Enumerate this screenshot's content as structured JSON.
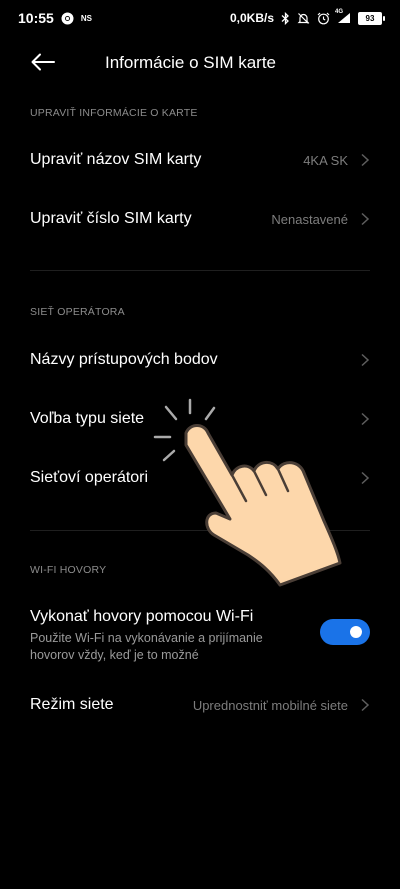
{
  "status_bar": {
    "time": "10:55",
    "ns_label": "NS",
    "speed": "0,0KB/s",
    "network_label": "4G",
    "battery": "93"
  },
  "header": {
    "title": "Informácie o SIM karte"
  },
  "sections": {
    "card_info": {
      "header": "UPRAVIŤ INFORMÁCIE O KARTE",
      "items": [
        {
          "label": "Upraviť názov SIM karty",
          "value": "4KA SK"
        },
        {
          "label": "Upraviť číslo SIM karty",
          "value": "Nenastavené"
        }
      ]
    },
    "operator_network": {
      "header": "SIEŤ OPERÁTORA",
      "items": [
        {
          "label": "Názvy prístupových bodov"
        },
        {
          "label": "Voľba typu siete"
        },
        {
          "label": "Sieťoví operátori"
        }
      ]
    },
    "wifi_calls": {
      "header": "WI-FI HOVORY",
      "title": "Vykonať hovory pomocou Wi-Fi",
      "description": "Použite Wi-Fi na vykonávanie a prijímanie hovorov vždy, keď je to možné",
      "toggle_on": true,
      "accent": "#1a73e8"
    },
    "network_mode": {
      "label": "Režim siete",
      "value": "Uprednostniť mobilné siete"
    }
  },
  "icons": {
    "back": "arrow-left-icon",
    "chevron": "chevron-right-icon",
    "pointer": "pointing-hand-icon"
  }
}
